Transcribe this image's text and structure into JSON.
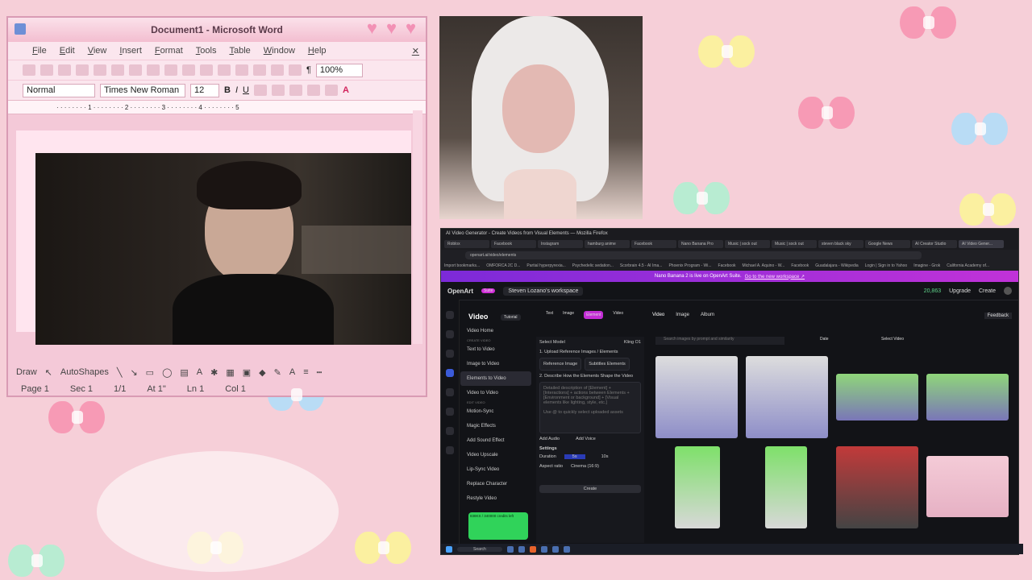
{
  "word": {
    "title": "Document1 - Microsoft Word",
    "menu": [
      "File",
      "Edit",
      "View",
      "Insert",
      "Format",
      "Tools",
      "Table",
      "Window",
      "Help"
    ],
    "zoom": "100%",
    "style": "Normal",
    "font": "Times New Roman",
    "size": "12",
    "draw_label": "Draw",
    "autoshapes_label": "AutoShapes",
    "status": {
      "page": "Page 1",
      "sec": "Sec 1",
      "count": "1/1",
      "at": "At 1\"",
      "ln": "Ln 1",
      "col": "Col 1"
    }
  },
  "firefox": {
    "window_title": "AI Video Generator - Create Videos from Visual Elements — Mozilla Firefox",
    "tabs": [
      "Roblox",
      "Facebook",
      "Instagram",
      "hamburg anime",
      "Facebook",
      "Nano Banana Pro",
      "Music | sock out",
      "Music | sock out",
      "steven black sky",
      "Google News",
      "AI Creator Studio",
      "AI Video Gener..."
    ],
    "url": "openart.ai/video/elements",
    "bookmarks": [
      "Import bookmarks...",
      "OMFORCA 2C D...",
      "Partial hyperpyrexia...",
      "Psychedelic sedation...",
      "Scorbrain 4.5 - AI Ima...",
      "Phoenix Program - Wi...",
      "Facebook",
      "Michael A. Aquino - W...",
      "Facebook",
      "Guadalajara - Wikipedia",
      "Login | Sign in to Yahoo",
      "Imagine - Grok",
      "California Academy of..."
    ],
    "banner_text": "Nano Banana 2 is live on OpenArt Suite.",
    "banner_link": "Go to the new workspace ↗",
    "brand": "OpenArt",
    "brand_badge": "Suite",
    "workspace": "Steven Lozano's workspace",
    "credits": "20,863",
    "upgrade": "Upgrade",
    "create": "Create",
    "section_title": "Video",
    "tutorial": "Tutorial",
    "modes": [
      "Text",
      "Image",
      "Element",
      "Video"
    ],
    "leftnav": [
      "Home",
      "Assets",
      "Story",
      "Video",
      "Image",
      "Character",
      "Audio",
      "More"
    ],
    "menu_group1": "CREATE VIDEO",
    "menu_group2": "EDIT VIDEO",
    "menu": [
      "Video Home",
      "Text to Video",
      "Image to Video",
      "Elements to Video",
      "Video to Video",
      "Motion-Sync",
      "Magic Effects",
      "Add Sound Effect",
      "Video Upscale",
      "Lip-Sync Video",
      "Replace Character",
      "Restyle Video"
    ],
    "credit_status": "838KS / 340000 credits left",
    "panel": {
      "select_model": "Select Model",
      "model": "Kling O1",
      "step1": "1. Upload Reference Images / Elements",
      "ref_images": "Reference Image",
      "sub_elements": "Subtitles Elements",
      "step2": "2. Describe How the Elements Shape the Video",
      "prompt_placeholder": "Detailed description of [Element] + [Interactions] + actions between Elements + [Environment or background] + [Visual elements like lighting, style, etc.]",
      "prompt_hint": "Use @ to quickly select uploaded assets",
      "add_audio": "Add Audio",
      "add_voice": "Add Voice",
      "settings": "Settings",
      "duration": "Duration",
      "dur_opts": [
        "5s",
        "10s"
      ],
      "aspect": "Aspect ratio",
      "aspect_val": "Cinema (16:9)",
      "create_btn": "Create"
    },
    "gallery_tabs": [
      "Video",
      "Image",
      "Album"
    ],
    "feedback": "Feedback",
    "search_placeholder": "Search images by prompt and similarity",
    "sort": "Date",
    "select_video": "Select Video"
  }
}
